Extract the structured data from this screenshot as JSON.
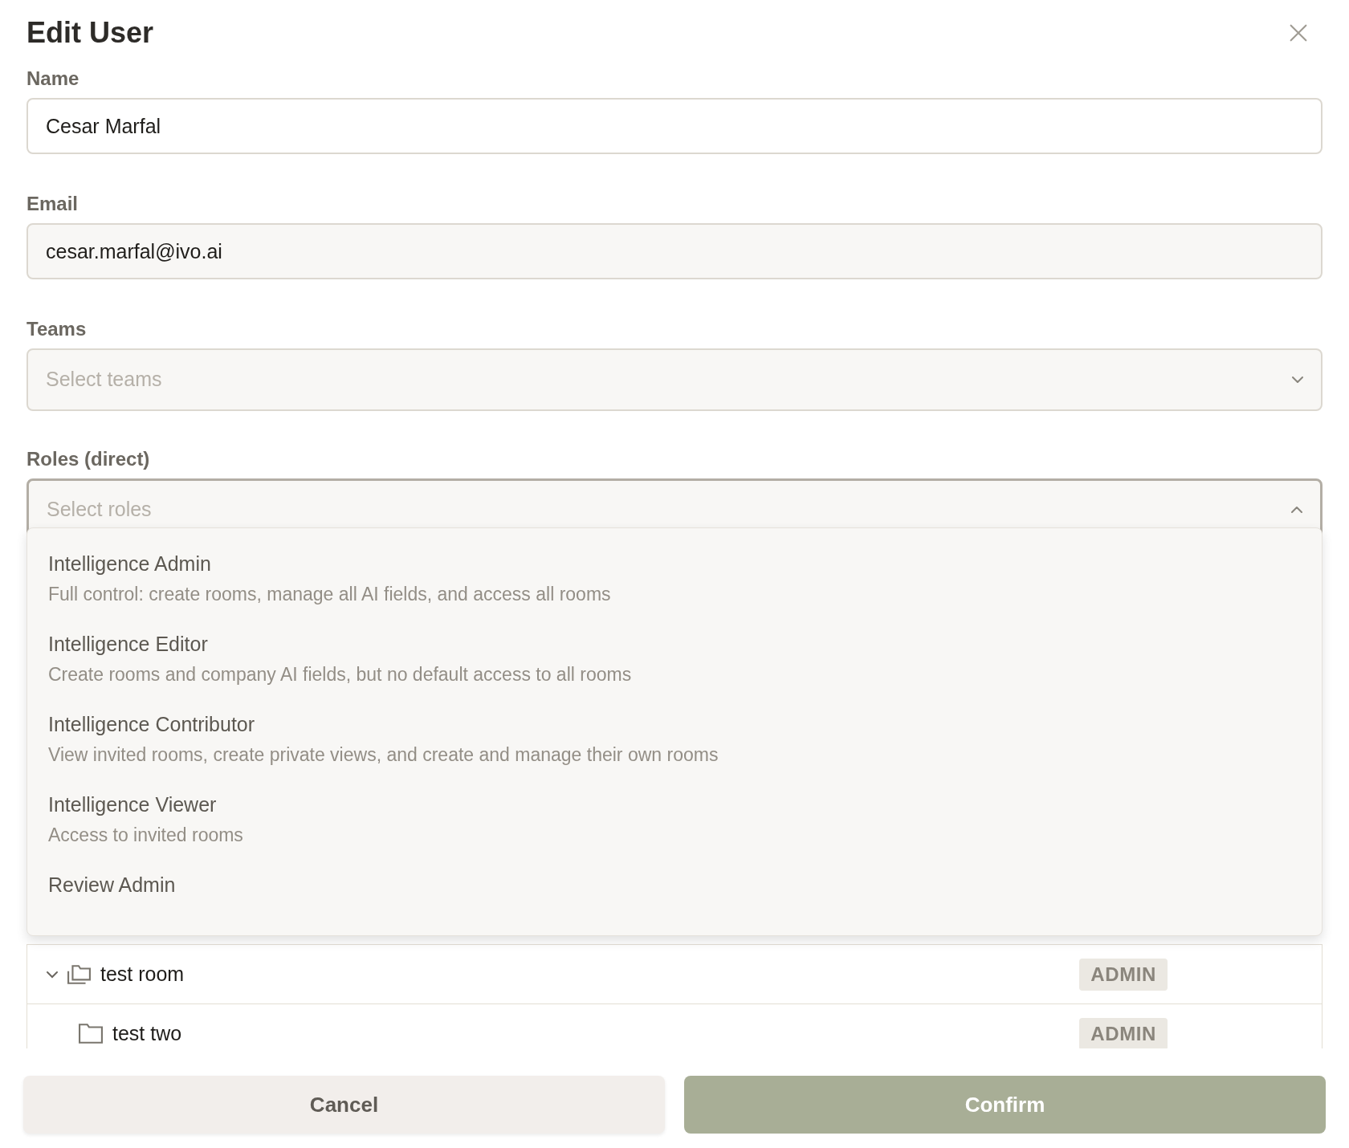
{
  "dialog": {
    "title": "Edit User"
  },
  "fields": [
    {
      "label": "Name",
      "value": "Cesar Marfal",
      "kind": "text"
    },
    {
      "label": "Email",
      "value": "cesar.marfal@ivo.ai",
      "kind": "readonly"
    }
  ],
  "teams": {
    "label": "Teams",
    "placeholder": "Select teams",
    "expanded": false
  },
  "roles": {
    "label": "Roles (direct)",
    "placeholder": "Select roles",
    "expanded": true,
    "options": [
      {
        "name": "Intelligence Admin",
        "description": "Full control: create rooms, manage all AI fields, and access all rooms"
      },
      {
        "name": "Intelligence Editor",
        "description": "Create rooms and company AI fields, but no default access to all rooms"
      },
      {
        "name": "Intelligence Contributor",
        "description": "View invited rooms, create private views, and create and manage their own rooms"
      },
      {
        "name": "Intelligence Viewer",
        "description": "Access to invited rooms"
      },
      {
        "name": "Review Admin"
      }
    ]
  },
  "rooms": [
    {
      "name": "test room",
      "role": "ADMIN",
      "expanded": true,
      "children": [
        {
          "name": "test two",
          "role": "ADMIN"
        }
      ]
    }
  ],
  "buttons": {
    "cancel": "Cancel",
    "confirm": "Confirm"
  }
}
